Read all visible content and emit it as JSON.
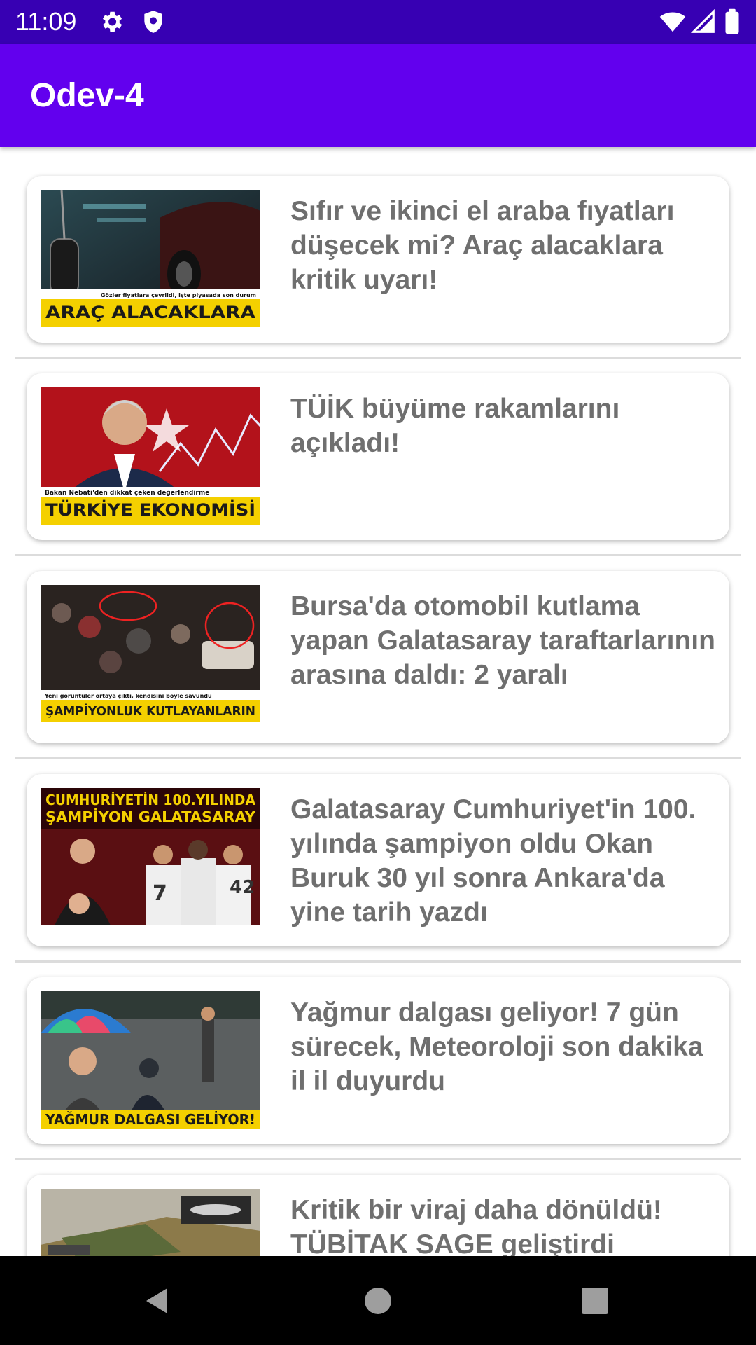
{
  "status_bar": {
    "time": "11:09",
    "icons": [
      "settings-icon",
      "shield-icon",
      "wifi-icon",
      "signal-icon",
      "battery-icon"
    ]
  },
  "app_bar": {
    "title": "Odev-4",
    "color": "#6200ee"
  },
  "news": [
    {
      "headline": "Sıfır ve ikinci el araba fıyatları düşecek mi? Araç alacaklara kritik uyarı!",
      "image_caption": "Gözler fiyatlara çevrildi, işte piyasada son durum",
      "image_title": "ARAÇ ALACAKLARA"
    },
    {
      "headline": "TÜİK büyüme rakamlarını açıkladı!",
      "image_caption": "Bakan Nebati'den dikkat çeken değerlendirme",
      "image_title": "TÜRKİYE EKONOMİSİ"
    },
    {
      "headline": "Bursa'da otomobil kutlama yapan Galatasaray taraftarlarının arasına daldı: 2 yaralı",
      "image_caption": "Yeni görüntüler ortaya çıktı, kendisini böyle savundu",
      "image_title": "ŞAMPİYONLUK KUTLAYANLARIN"
    },
    {
      "headline": "Galatasaray Cumhuriyet'in 100. yılında şampiyon oldu Okan Buruk 30 yıl sonra Ankara'da yine tarih yazdı",
      "image_caption": "CUMHURİYETİN 100.YILINDA",
      "image_title": "ŞAMPİYON GALATASARAY"
    },
    {
      "headline": "Yağmur dalgası geliyor! 7 gün sürecek, Meteoroloji son dakika il il duyurdu",
      "image_caption": "",
      "image_title": "YAĞMUR DALGASI GELİYOR!"
    },
    {
      "headline": "Kritik bir viraj daha dönüldü! TÜBİTAK SAGE geliştirdi",
      "image_caption": "",
      "image_title": ""
    }
  ],
  "nav_bar": {
    "buttons": [
      "back-icon",
      "home-icon",
      "recents-icon"
    ]
  }
}
